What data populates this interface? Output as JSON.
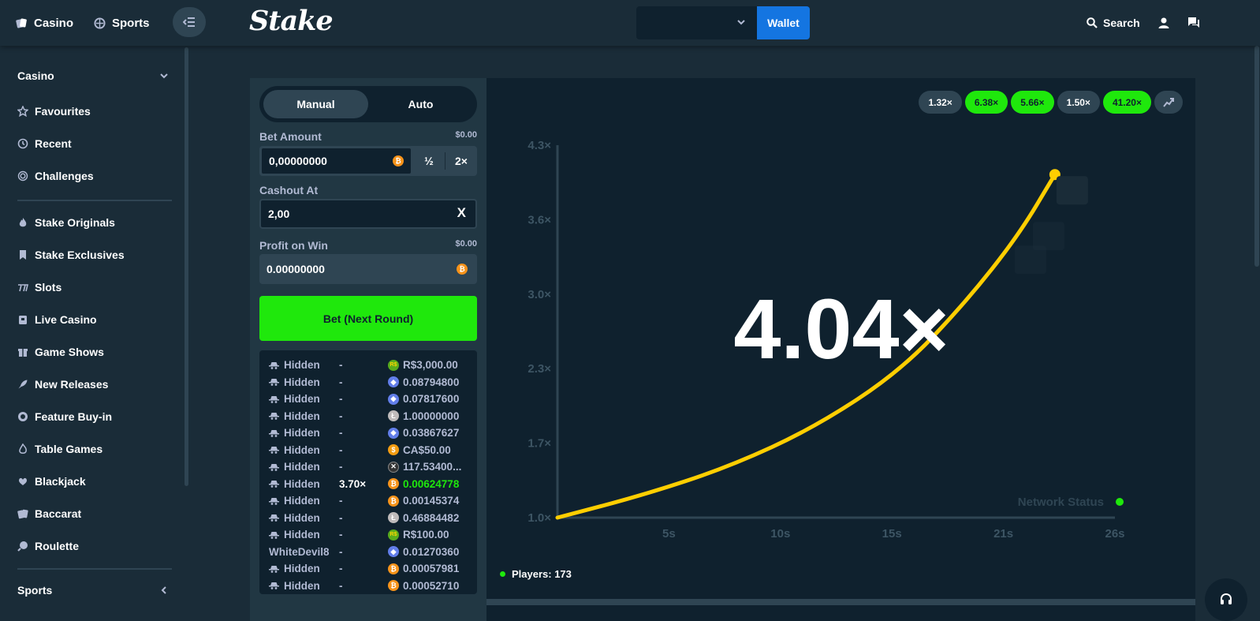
{
  "header": {
    "casino_tab": "Casino",
    "sports_tab": "Sports",
    "logo": "Stake",
    "wallet_label": "Wallet",
    "search_label": "Search"
  },
  "sidebar": {
    "casino_heading": "Casino",
    "items": [
      {
        "label": "Favourites",
        "icon": "star-icon"
      },
      {
        "label": "Recent",
        "icon": "history-icon"
      },
      {
        "label": "Challenges",
        "icon": "target-icon"
      },
      {
        "label": "Stake Originals",
        "icon": "flame-icon"
      },
      {
        "label": "Stake Exclusives",
        "icon": "bookmark-icon"
      },
      {
        "label": "Slots",
        "icon": "slots-icon"
      },
      {
        "label": "Live Casino",
        "icon": "live-icon"
      },
      {
        "label": "Game Shows",
        "icon": "gift-icon"
      },
      {
        "label": "New Releases",
        "icon": "rocket-icon"
      },
      {
        "label": "Feature Buy-in",
        "icon": "coin-icon"
      },
      {
        "label": "Table Games",
        "icon": "fire-icon"
      },
      {
        "label": "Blackjack",
        "icon": "cards-icon"
      },
      {
        "label": "Baccarat",
        "icon": "cards-icon"
      },
      {
        "label": "Roulette",
        "icon": "roulette-icon"
      }
    ],
    "sports_heading": "Sports"
  },
  "bet_panel": {
    "mode_manual": "Manual",
    "mode_auto": "Auto",
    "bet_amount_label": "Bet Amount",
    "bet_amount_usd": "$0.00",
    "bet_amount_value": "0,00000000",
    "half_label": "½",
    "double_label": "2×",
    "cashout_label": "Cashout At",
    "cashout_value": "2,00",
    "cashout_clear": "X",
    "profit_label": "Profit on Win",
    "profit_usd": "$0.00",
    "profit_value": "0.00000000",
    "bet_button": "Bet (Next Round)"
  },
  "players_list": [
    {
      "name": "Hidden",
      "mult": "-",
      "coin": "brl",
      "amount": "R$3,000.00"
    },
    {
      "name": "Hidden",
      "mult": "-",
      "coin": "eth",
      "amount": "0.08794800"
    },
    {
      "name": "Hidden",
      "mult": "-",
      "coin": "eth",
      "amount": "0.07817600"
    },
    {
      "name": "Hidden",
      "mult": "-",
      "coin": "ltc",
      "amount": "1.00000000"
    },
    {
      "name": "Hidden",
      "mult": "-",
      "coin": "eth",
      "amount": "0.03867627"
    },
    {
      "name": "Hidden",
      "mult": "-",
      "coin": "cad",
      "amount": "CA$50.00"
    },
    {
      "name": "Hidden",
      "mult": "-",
      "coin": "xrp",
      "amount": "117.53400..."
    },
    {
      "name": "Hidden",
      "mult": "3.70×",
      "coin": "btc",
      "amount": "0.00624778",
      "win": true
    },
    {
      "name": "Hidden",
      "mult": "-",
      "coin": "btc",
      "amount": "0.00145374"
    },
    {
      "name": "Hidden",
      "mult": "-",
      "coin": "ltc",
      "amount": "0.46884482"
    },
    {
      "name": "Hidden",
      "mult": "-",
      "coin": "brl",
      "amount": "R$100.00"
    },
    {
      "name": "WhiteDevil8",
      "mult": "-",
      "coin": "eth",
      "amount": "0.01270360"
    },
    {
      "name": "Hidden",
      "mult": "-",
      "coin": "btc",
      "amount": "0.00057981"
    },
    {
      "name": "Hidden",
      "mult": "-",
      "coin": "btc",
      "amount": "0.00052710"
    }
  ],
  "history_pills": [
    {
      "label": "1.32×",
      "green": false
    },
    {
      "label": "6.38×",
      "green": true
    },
    {
      "label": "5.66×",
      "green": true
    },
    {
      "label": "1.50×",
      "green": false
    },
    {
      "label": "41.20×",
      "green": true
    }
  ],
  "game": {
    "current_multiplier": "4.04×",
    "network_status": "Network Status",
    "players_count": "Players: 173"
  },
  "chart_data": {
    "type": "line",
    "y_ticks": [
      "1.0×",
      "1.7×",
      "2.3×",
      "3.0×",
      "3.6×",
      "4.3×"
    ],
    "x_ticks": [
      "5s",
      "10s",
      "15s",
      "21s",
      "26s"
    ],
    "ylim": [
      1.0,
      4.3
    ],
    "xlim": [
      0,
      26
    ],
    "series": [
      {
        "values": [
          [
            0,
            1.0
          ],
          [
            4,
            1.2
          ],
          [
            8,
            1.45
          ],
          [
            12,
            1.8
          ],
          [
            16,
            2.3
          ],
          [
            19,
            2.9
          ],
          [
            21.5,
            3.5
          ],
          [
            23.2,
            4.04
          ]
        ]
      }
    ],
    "accent": "#ffce00"
  },
  "colors": {
    "accent_green": "#1fe80c",
    "wallet_blue": "#1475e1",
    "curve": "#ffce00"
  }
}
